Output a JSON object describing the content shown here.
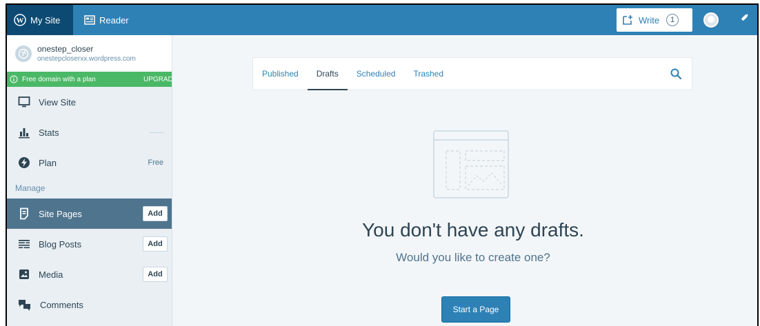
{
  "masterbar": {
    "my_site_label": "My Site",
    "reader_label": "Reader",
    "write_label": "Write",
    "write_count": "1",
    "colors": {
      "bar": "#2e81b5",
      "active": "#0d4a73"
    }
  },
  "sidebar": {
    "site_name": "onestep_closer",
    "site_url": "onestepcloserxx.wordpress.com",
    "promo_text": "Free domain with a plan",
    "promo_action": "UPGRAD",
    "items": [
      {
        "label": "View Site",
        "icon": "monitor-icon"
      },
      {
        "label": "Stats",
        "icon": "stats-icon"
      },
      {
        "label": "Plan",
        "icon": "plan-icon",
        "badge": "Free"
      }
    ],
    "section_manage": "Manage",
    "manage_items": [
      {
        "label": "Site Pages",
        "icon": "page-icon",
        "action": "Add",
        "selected": true
      },
      {
        "label": "Blog Posts",
        "icon": "posts-icon",
        "action": "Add"
      },
      {
        "label": "Media",
        "icon": "media-icon",
        "action": "Add"
      },
      {
        "label": "Comments",
        "icon": "comments-icon"
      }
    ]
  },
  "main": {
    "tabs": [
      {
        "label": "Published"
      },
      {
        "label": "Drafts",
        "active": true
      },
      {
        "label": "Scheduled"
      },
      {
        "label": "Trashed"
      }
    ],
    "empty_title": "You don't have any drafts.",
    "empty_subtitle": "Would you like to create one?",
    "cta_label": "Start a Page"
  }
}
